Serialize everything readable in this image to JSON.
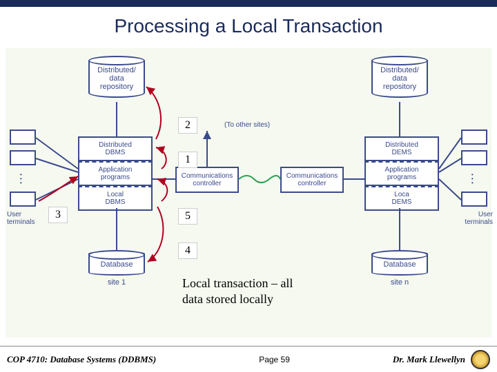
{
  "title": "Processing a Local Transaction",
  "nodes": {
    "repo_left": "Distributed/\ndata\nrepository",
    "repo_right": "Distributed/\ndata\nrepository",
    "stack_left": {
      "r1": "Distributed\nDBMS",
      "r2": "Application\nprograms",
      "r3": "Local\nDBMS"
    },
    "stack_right": {
      "r1": "Distributed\nDEMS",
      "r2": "Application\nprograms",
      "r3": "Loca\nDEMS"
    },
    "comm_left": "Communications\ncontroller",
    "comm_right": "Communications\ncontroller",
    "db_left": "Database",
    "db_left_site": "site 1",
    "db_right": "Database",
    "db_right_site": "site n",
    "terminals_label": "User\nterminals",
    "to_other": "(To other sites)"
  },
  "numbers": {
    "n1": "1",
    "n2": "2",
    "n3": "3",
    "n4": "4",
    "n5": "5"
  },
  "caption": "Local transaction – all\ndata stored locally",
  "footer": {
    "course": "COP 4710: Database Systems  (DDBMS)",
    "page": "Page 59",
    "author": "Dr. Mark Llewellyn"
  }
}
